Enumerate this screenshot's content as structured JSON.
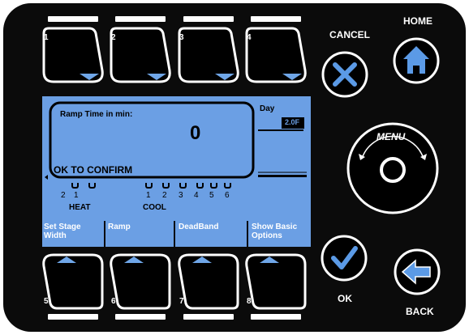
{
  "soft_keys_top": [
    {
      "number": "1"
    },
    {
      "number": "2"
    },
    {
      "number": "3"
    },
    {
      "number": "4"
    }
  ],
  "soft_keys_bottom": [
    {
      "number": "5",
      "label": "Set Stage Width"
    },
    {
      "number": "6",
      "label": "Ramp"
    },
    {
      "number": "7",
      "label": "DeadBand"
    },
    {
      "number": "8",
      "label": "Show Basic Options"
    }
  ],
  "display": {
    "prompt": "Ramp Time in min:",
    "value": "0",
    "confirm": "OK TO CONFIRM",
    "day_label": "Day",
    "setpoint": "2.0F",
    "heat_numbers": [
      "2",
      "1"
    ],
    "heat_label": "HEAT",
    "cool_numbers": [
      "1",
      "2",
      "3",
      "4",
      "5",
      "6"
    ],
    "cool_label": "COOL"
  },
  "controls": {
    "cancel_label": "CANCEL",
    "home_label": "HOME",
    "menu_label": "MENU",
    "ok_label": "OK",
    "back_label": "BACK"
  },
  "colors": {
    "lcd": "#6b9fe4",
    "panel": "#0b0b0b",
    "key_fill": "#ffffff",
    "key_glow": "#6fa6e8"
  }
}
